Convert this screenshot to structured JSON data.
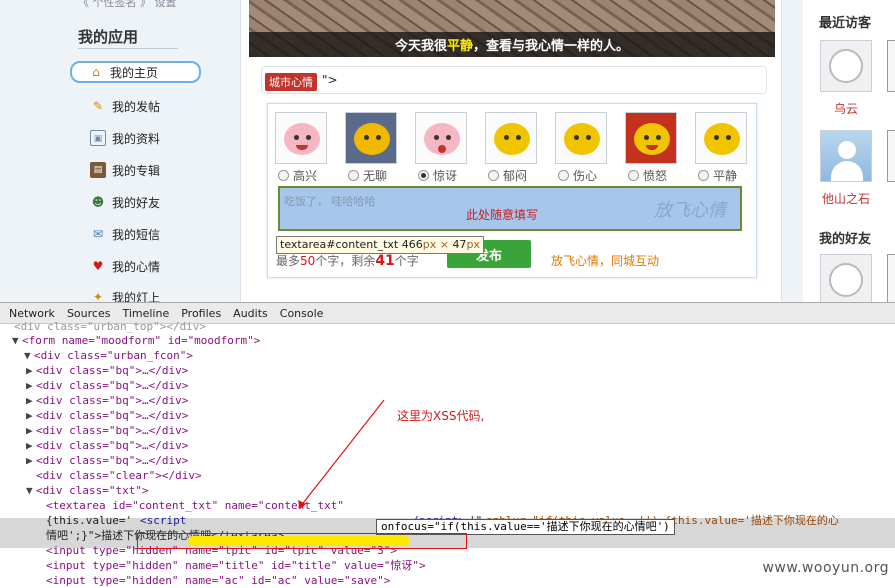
{
  "sidebar": {
    "top_link": "《 个性签名 》 设置",
    "title": "我的应用",
    "items": [
      {
        "label": "我的主页",
        "icon": "home-icon"
      },
      {
        "label": "我的发帖",
        "icon": "pencil-icon"
      },
      {
        "label": "我的资料",
        "icon": "profile-card-icon"
      },
      {
        "label": "我的专辑",
        "icon": "album-icon"
      },
      {
        "label": "我的好友",
        "icon": "friends-icon"
      },
      {
        "label": "我的短信",
        "icon": "envelope-icon"
      },
      {
        "label": "我的心情",
        "icon": "heart-icon"
      },
      {
        "label": "我的灯上",
        "icon": "lamp-icon"
      }
    ]
  },
  "main": {
    "banner_prefix": "今天我很",
    "banner_highlight": "平静",
    "banner_suffix": "，查看与我心情一样的人。",
    "city_tag": "城市心情",
    "city_after": "\">",
    "moods": [
      "高兴",
      "无聊",
      "惊讶",
      "郁闷",
      "伤心",
      "愤怒",
      "平静"
    ],
    "selected_mood": "惊讶",
    "textarea_placeholder": "吃饭了， 哇哈哈哈",
    "textarea_note": "此处随意填写",
    "textarea_watermark": "放飞心情",
    "tooltip_selector": "textarea#content_txt",
    "tooltip_width": "466",
    "tooltip_height": "47",
    "tooltip_unit": "px",
    "tooltip_times": "×",
    "limit_prefix": "最多",
    "limit_max": "50",
    "limit_mid": "个字，剩余",
    "limit_remaining": "41",
    "limit_suffix": "个字",
    "publish_label": "发布",
    "slogan": "放飞心情，同城互动"
  },
  "right": {
    "recent_title": "最近访客",
    "visitors": [
      "乌云",
      "他山之石"
    ],
    "friends_title": "我的好友"
  },
  "devtools": {
    "tabs": [
      "Network",
      "Sources",
      "Timeline",
      "Profiles",
      "Audits",
      "Console"
    ],
    "annotation": "这里为XSS代码,",
    "popup": "onfocus=\"if(this.value=='描述下你现在的心情吧')",
    "watermark": "www.wooyun.org",
    "lines": {
      "l0": "<div class=\"urban_top\"></div>",
      "form_open": "<form name=\"moodform\" id=\"moodform\">",
      "div_fcon": "<div class=\"urban_fcon\">",
      "bq": "<div class=\"bq\">…</div>",
      "clear": "<div class=\"clear\"></div>",
      "txt": "<div class=\"txt\">",
      "textarea_open": "<textarea id=\"content_txt\" name=\"content_txt\"",
      "thisval": "{this.value='",
      "script_open": "<script",
      "script_close": "/script>",
      "after_box": "'\"",
      "onblur": "onblur=\"if(this.value=='') {this.value='描述下你现在的心",
      "textarea_close": "情吧';}\">描述下你现在的心情吧</textarea>",
      "hidden1": "<input type=\"hidden\" name=\"tpic\" id=\"tpic\" value=\"3\">",
      "hidden2": "<input type=\"hidden\" name=\"title\" id=\"title\" value=\"惊讶\">",
      "hidden3": "<input type=\"hidden\" name=\"ac\" id=\"ac\" value=\"save\">"
    }
  }
}
